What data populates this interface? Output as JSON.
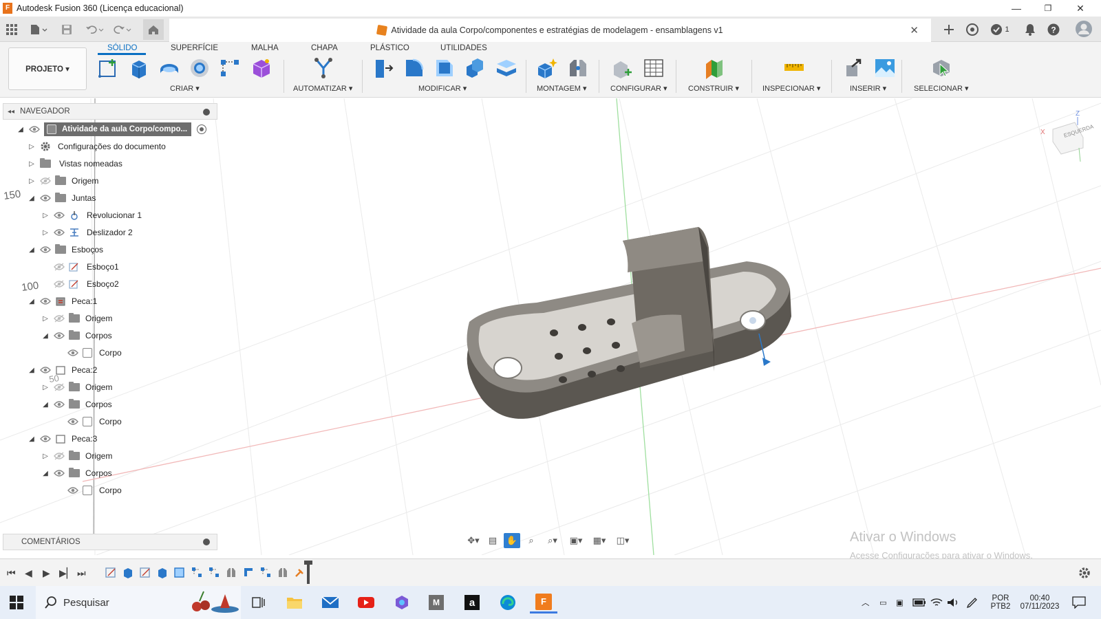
{
  "window": {
    "title": "Autodesk Fusion 360 (Licença educacional)",
    "controls": {
      "minimize": "—",
      "restore": "❐",
      "close": "✕"
    }
  },
  "document": {
    "title": "Atividade da aula Corpo/componentes e estratégias de modelagem - ensamblagens v1",
    "close": "✕",
    "job_count": "1"
  },
  "ribbon": {
    "workspace_button": "PROJETO ▾",
    "tabs": [
      "SÓLIDO",
      "SUPERFÍCIE",
      "MALHA",
      "CHAPA",
      "PLÁSTICO",
      "UTILIDADES"
    ],
    "active_tab": "SÓLIDO",
    "groups": [
      "CRIAR ▾",
      "AUTOMATIZAR ▾",
      "MODIFICAR ▾",
      "MONTAGEM ▾",
      "CONFIGURAR ▾",
      "CONSTRUIR ▾",
      "INSPECIONAR ▾",
      "INSERIR ▾",
      "SELECIONAR ▾"
    ]
  },
  "navigator": {
    "title": "NAVEGADOR",
    "root": "Atividade da aula Corpo/compo...",
    "rows": [
      {
        "label": "Configurações do documento",
        "twisty": "▷",
        "icon": "gear-icon"
      },
      {
        "label": "Vistas nomeadas",
        "twisty": "▷",
        "icon": "folder-icon"
      },
      {
        "label": "Origem",
        "twisty": "▷",
        "icon": "folder-icon"
      },
      {
        "label": "Juntas",
        "twisty": "◢",
        "icon": "folder-icon"
      },
      {
        "label": "Revolucionar 1",
        "twisty": "▷",
        "icon": "revolute-joint-icon"
      },
      {
        "label": "Deslizador 2",
        "twisty": "▷",
        "icon": "slider-joint-icon"
      },
      {
        "label": "Esboços",
        "twisty": "◢",
        "icon": "folder-icon"
      },
      {
        "label": "Esboço1",
        "twisty": "",
        "icon": "sketch-icon"
      },
      {
        "label": "Esboço2",
        "twisty": "",
        "icon": "sketch-icon"
      },
      {
        "label": "Peca:1",
        "twisty": "◢",
        "icon": "component-icon"
      },
      {
        "label": "Origem",
        "twisty": "▷",
        "icon": "folder-icon"
      },
      {
        "label": "Corpos",
        "twisty": "◢",
        "icon": "folder-icon"
      },
      {
        "label": "Corpo",
        "twisty": "",
        "icon": "body-icon"
      },
      {
        "label": "Peca:2",
        "twisty": "◢",
        "icon": "component-icon"
      },
      {
        "label": "Origem",
        "twisty": "▷",
        "icon": "folder-icon"
      },
      {
        "label": "Corpos",
        "twisty": "◢",
        "icon": "folder-icon"
      },
      {
        "label": "Corpo",
        "twisty": "",
        "icon": "body-icon"
      },
      {
        "label": "Peca:3",
        "twisty": "◢",
        "icon": "component-icon"
      },
      {
        "label": "Origem",
        "twisty": "▷",
        "icon": "folder-icon"
      },
      {
        "label": "Corpos",
        "twisty": "◢",
        "icon": "folder-icon"
      },
      {
        "label": "Corpo",
        "twisty": "",
        "icon": "body-icon"
      }
    ]
  },
  "canvas": {
    "ruler_labels": [
      "150",
      "100",
      "50"
    ],
    "viewcube_label": "ESQUERDA",
    "axis_labels": {
      "x": "X",
      "z": "Z"
    }
  },
  "comments": {
    "title": "COMENTÁRIOS"
  },
  "watermark": {
    "line1": "Ativar o Windows",
    "line2": "Acesse Configurações para ativar o Windows."
  },
  "taskbar": {
    "search_placeholder": "Pesquisar",
    "language": "POR",
    "layout": "PTB2",
    "time": "00:40",
    "date": "07/11/2023"
  },
  "colors": {
    "accent": "#0a6fc2",
    "fusion_orange": "#e8731c",
    "model_gray": "#6f6a63"
  }
}
